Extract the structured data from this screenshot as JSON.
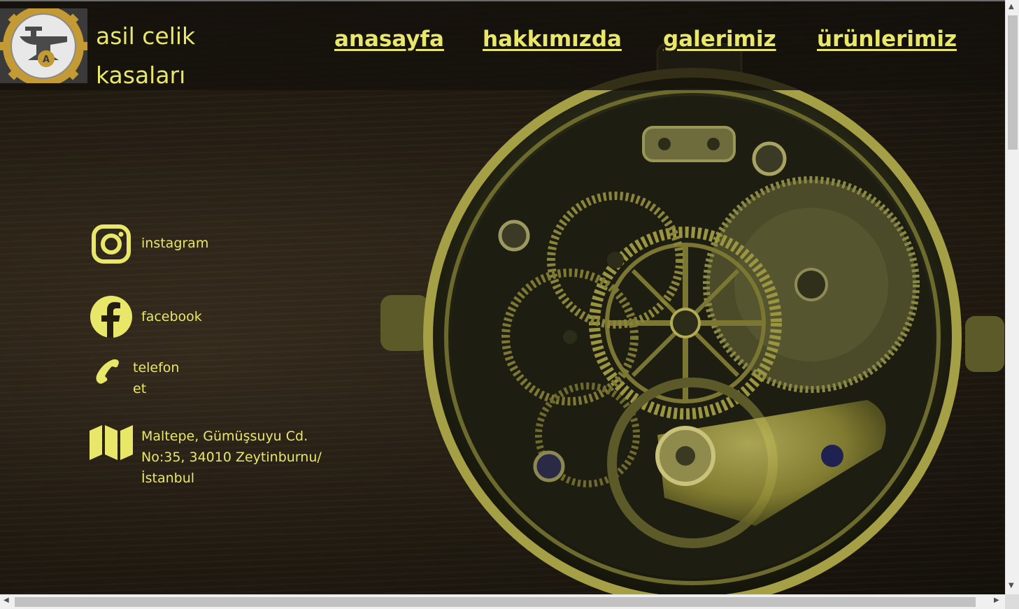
{
  "brand": {
    "line1": "asil celik",
    "line2": "kasaları",
    "logo_letter": "A"
  },
  "nav": {
    "home": "anasayfa",
    "about": "hakkımızda",
    "gallery": "galerimiz",
    "products": "ürünlerimiz"
  },
  "contact": {
    "instagram": "instagram",
    "facebook": "facebook",
    "phone_line1": "telefon",
    "phone_line2": "et",
    "address_line1": "Maltepe, Gümüşsuyu Cd.",
    "address_line2": "No:35, 34010 Zeytinburnu/",
    "address_line3": "İstanbul"
  },
  "icons": {
    "instagram": "instagram-icon",
    "facebook": "facebook-icon",
    "phone": "phone-icon",
    "map": "map-icon"
  },
  "colors": {
    "accent": "#e9e76a",
    "header_bg": "#14110c",
    "page_bg": "#2a2216"
  }
}
